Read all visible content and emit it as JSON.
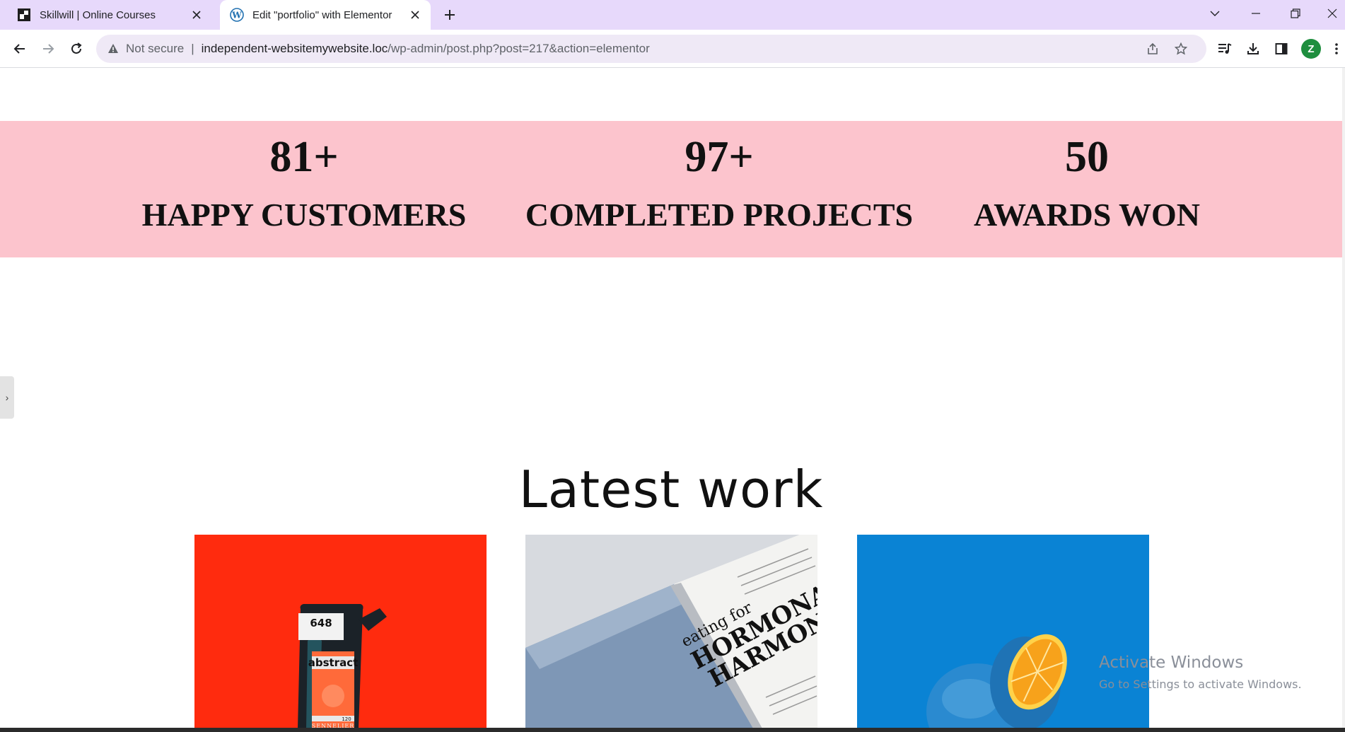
{
  "browser": {
    "tabs": [
      {
        "title": "Skillwill | Online Courses",
        "active": false
      },
      {
        "title": "Edit \"portfolio\" with Elementor",
        "active": true
      }
    ],
    "address": {
      "security_label": "Not secure",
      "separator": "|",
      "host": "independent-websitemywebsite.loc",
      "path": "/wp-admin/post.php?post=217&action=elementor"
    },
    "profile_initial": "Z",
    "accent_color": "#e7d9fb"
  },
  "stats": [
    {
      "number": "81+",
      "label": "HAPPY CUSTOMERS"
    },
    {
      "number": "97+",
      "label": "COMPLETED PROJECTS"
    },
    {
      "number": "50",
      "label": "AWARDS WON"
    }
  ],
  "stats_band_color": "#fcc4cd",
  "latest_work": {
    "title": "Latest work",
    "cards": [
      {
        "image": "orange-paint-pouch",
        "color": "#ff2b0e",
        "pouch_number": "648",
        "pouch_brand": "abstract",
        "pouch_size": "120",
        "pouch_maker": "SENNELIER"
      },
      {
        "image": "magazine-hormonal-harmony",
        "color": "#cfd3d9",
        "headline_small": "eating for",
        "headline_big_1": "HORMONAL",
        "headline_big_2": "HARMONY"
      },
      {
        "image": "orange-on-blue",
        "color": "#0a83d4"
      }
    ]
  },
  "watermark": {
    "title": "Activate Windows",
    "subtitle": "Go to Settings to activate Windows."
  }
}
